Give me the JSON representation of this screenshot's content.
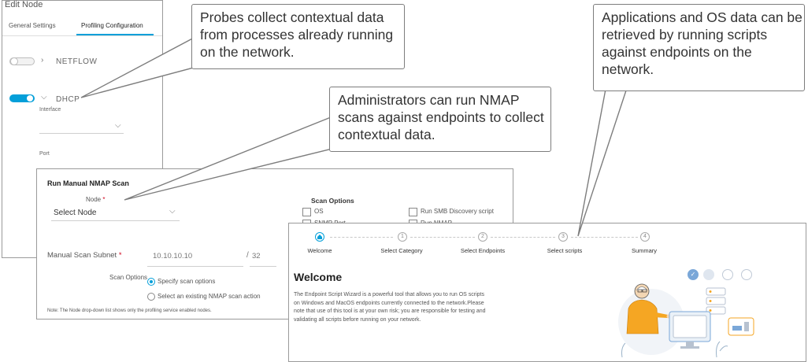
{
  "edit_node": {
    "title": "Edit Node",
    "tabs": [
      {
        "label": "General Settings"
      },
      {
        "label": "Profiling Configuration"
      }
    ],
    "probes": [
      {
        "label": "NETFLOW",
        "enabled": false
      },
      {
        "label": "DHCP",
        "enabled": true
      }
    ],
    "interface_label": "Interface",
    "port_label": "Port"
  },
  "nmap": {
    "title": "Run Manual NMAP Scan",
    "node_label": "Node",
    "node_required": "*",
    "node_value": "Select Node",
    "subnet_label": "Manual Scan Subnet",
    "subnet_required": "*",
    "subnet_ip": "10.10.10.10",
    "subnet_sep": "/",
    "subnet_mask": "32",
    "scan_options_label": "Scan Options",
    "radio_options": [
      {
        "label": "Specify scan options",
        "selected": true
      },
      {
        "label": "Select an existing NMAP scan action",
        "selected": false
      }
    ],
    "note": "Note: The Node drop-down list shows only the profiling service enabled nodes.",
    "options_header": "Scan Options",
    "checkboxes": [
      {
        "label": "OS"
      },
      {
        "label": "Run SMB Discovery script"
      },
      {
        "label": "SNMP Port"
      },
      {
        "label": "Run NMAP ..."
      }
    ]
  },
  "wizard": {
    "steps": [
      {
        "number": "",
        "label": "Welcome",
        "active": true
      },
      {
        "number": "1",
        "label": "Select Category",
        "active": false
      },
      {
        "number": "2",
        "label": "Select Endpoints",
        "active": false
      },
      {
        "number": "3",
        "label": "Select scripts",
        "active": false
      },
      {
        "number": "4",
        "label": "Summary",
        "active": false
      }
    ],
    "title": "Welcome",
    "description": "The Endpoint Script Wizard is a powerful tool that allows you to run OS scripts on Windows and MacOS endpoints currently connected to the network.Please note that use of this tool is at your own risk; you are responsible for testing and validating all scripts before running on your network.",
    "progress_check": "✓"
  },
  "callouts": {
    "probes": "Probes collect contextual data from processes already running on the network.",
    "nmap": "Administrators can run NMAP scans against endpoints to collect contextual data.",
    "scripts": "Applications and OS data can be retrieved by running scripts against endpoints on the network."
  },
  "colors": {
    "accent": "#049fd9",
    "border": "#9a9a9a",
    "illustration_shirt": "#f5a623"
  },
  "icons": [
    "home-icon",
    "chevron-right-icon",
    "chevron-down-icon",
    "check-icon"
  ]
}
